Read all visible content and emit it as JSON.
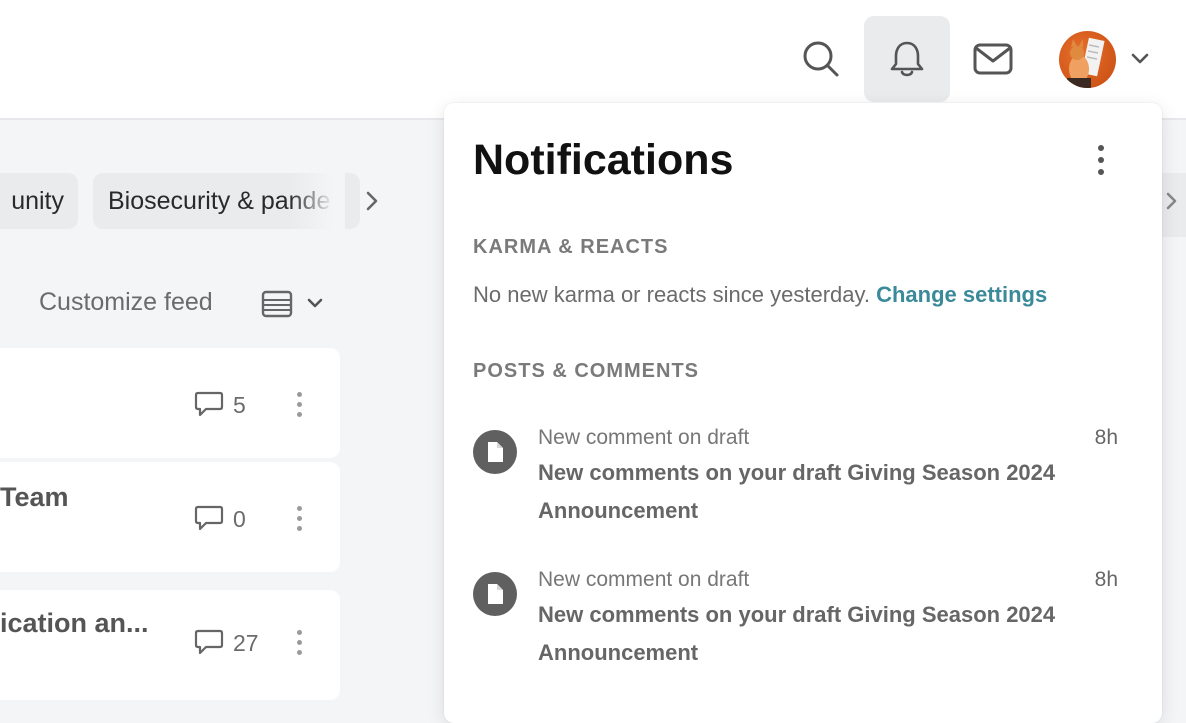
{
  "header": {
    "search_icon": "search-icon",
    "bell_icon": "bell-icon",
    "mail_icon": "mail-icon",
    "avatar": "user-avatar"
  },
  "tags": {
    "items": [
      "unity",
      "Biosecurity & pande"
    ]
  },
  "feed": {
    "customize_label": "Customize feed",
    "posts": [
      {
        "title": "",
        "comments": "5"
      },
      {
        "title": "Team",
        "comments": "0"
      },
      {
        "title": "ication an...",
        "comments": "27"
      }
    ]
  },
  "notifications": {
    "title": "Notifications",
    "karma_heading": "KARMA & REACTS",
    "karma_text": "No new karma or reacts since yesterday.",
    "karma_link": "Change settings",
    "posts_heading": "POSTS & COMMENTS",
    "items": [
      {
        "type": "New comment on draft",
        "time": "8h",
        "text": "New comments on your draft Giving Season 2024 Announcement"
      },
      {
        "type": "New comment on draft",
        "time": "8h",
        "text": "New comments on your draft Giving Season 2024 Announcement"
      }
    ]
  }
}
